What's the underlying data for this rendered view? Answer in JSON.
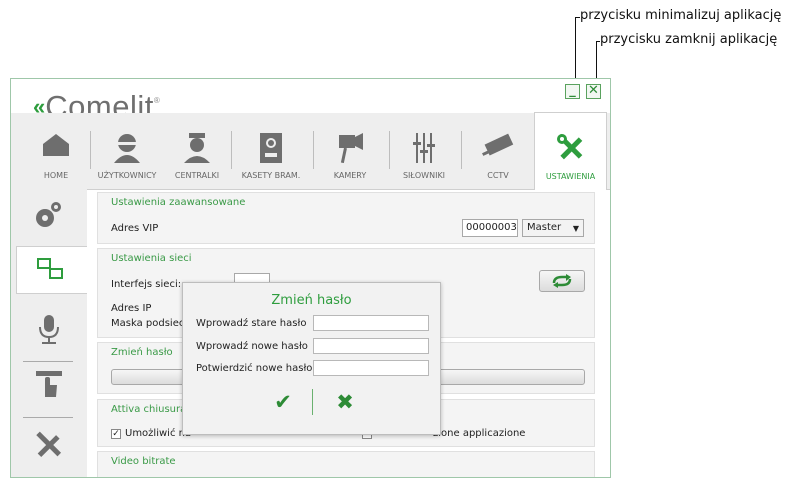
{
  "callouts": {
    "minimize": "przycisku minimalizuj aplikację",
    "close": "przycisku zamknij aplikację"
  },
  "app": {
    "logo_text": "Comelit",
    "window_buttons": {
      "minimize": "_",
      "close": "✕"
    }
  },
  "tabs": [
    {
      "label": "HOME",
      "icon": "home-icon"
    },
    {
      "label": "UŻYTKOWNICY",
      "icon": "user-icon"
    },
    {
      "label": "CENTRALKI",
      "icon": "concierge-icon"
    },
    {
      "label": "KASETY BRAM.",
      "icon": "door-panel-icon"
    },
    {
      "label": "KAMERY",
      "icon": "camera-icon"
    },
    {
      "label": "SIŁOWNIKI",
      "icon": "actuator-icon"
    },
    {
      "label": "CCTV",
      "icon": "cctv-icon"
    },
    {
      "label": "USTAWIENIA",
      "icon": "settings-tools-icon",
      "active": true
    }
  ],
  "sidebar": [
    {
      "icon": "gears-icon"
    },
    {
      "icon": "network-icon",
      "active": true
    },
    {
      "icon": "microphone-icon"
    },
    {
      "icon": "touch-icon"
    },
    {
      "icon": "tools-icon"
    }
  ],
  "sections": {
    "advanced": {
      "title": "Ustawienia zaawansowane",
      "label": "Adres VIP",
      "value": "00000003",
      "select": "Master"
    },
    "network": {
      "title": "Ustawienia sieci",
      "interface_label": "Interfejs sieci:",
      "ip_label": "Adres IP",
      "mask_label": "Maska podsieci"
    },
    "password": {
      "title": "Zmień hasło"
    },
    "closure": {
      "title": "Attiva chiusura/",
      "checkbox_label": "Umożliwić na",
      "checkbox2_label": "zione applicazione"
    },
    "video": {
      "title": "Video bitrate"
    }
  },
  "dialog": {
    "title": "Zmień hasło",
    "old_label": "Wprowadź stare hasło",
    "new_label": "Wprowadź nowe hasło",
    "confirm_label": "Potwierdzić nowe hasło",
    "ok": "✔",
    "cancel": "✖"
  },
  "colors": {
    "accent": "#2e9d3e",
    "border": "#9fc7a9"
  }
}
